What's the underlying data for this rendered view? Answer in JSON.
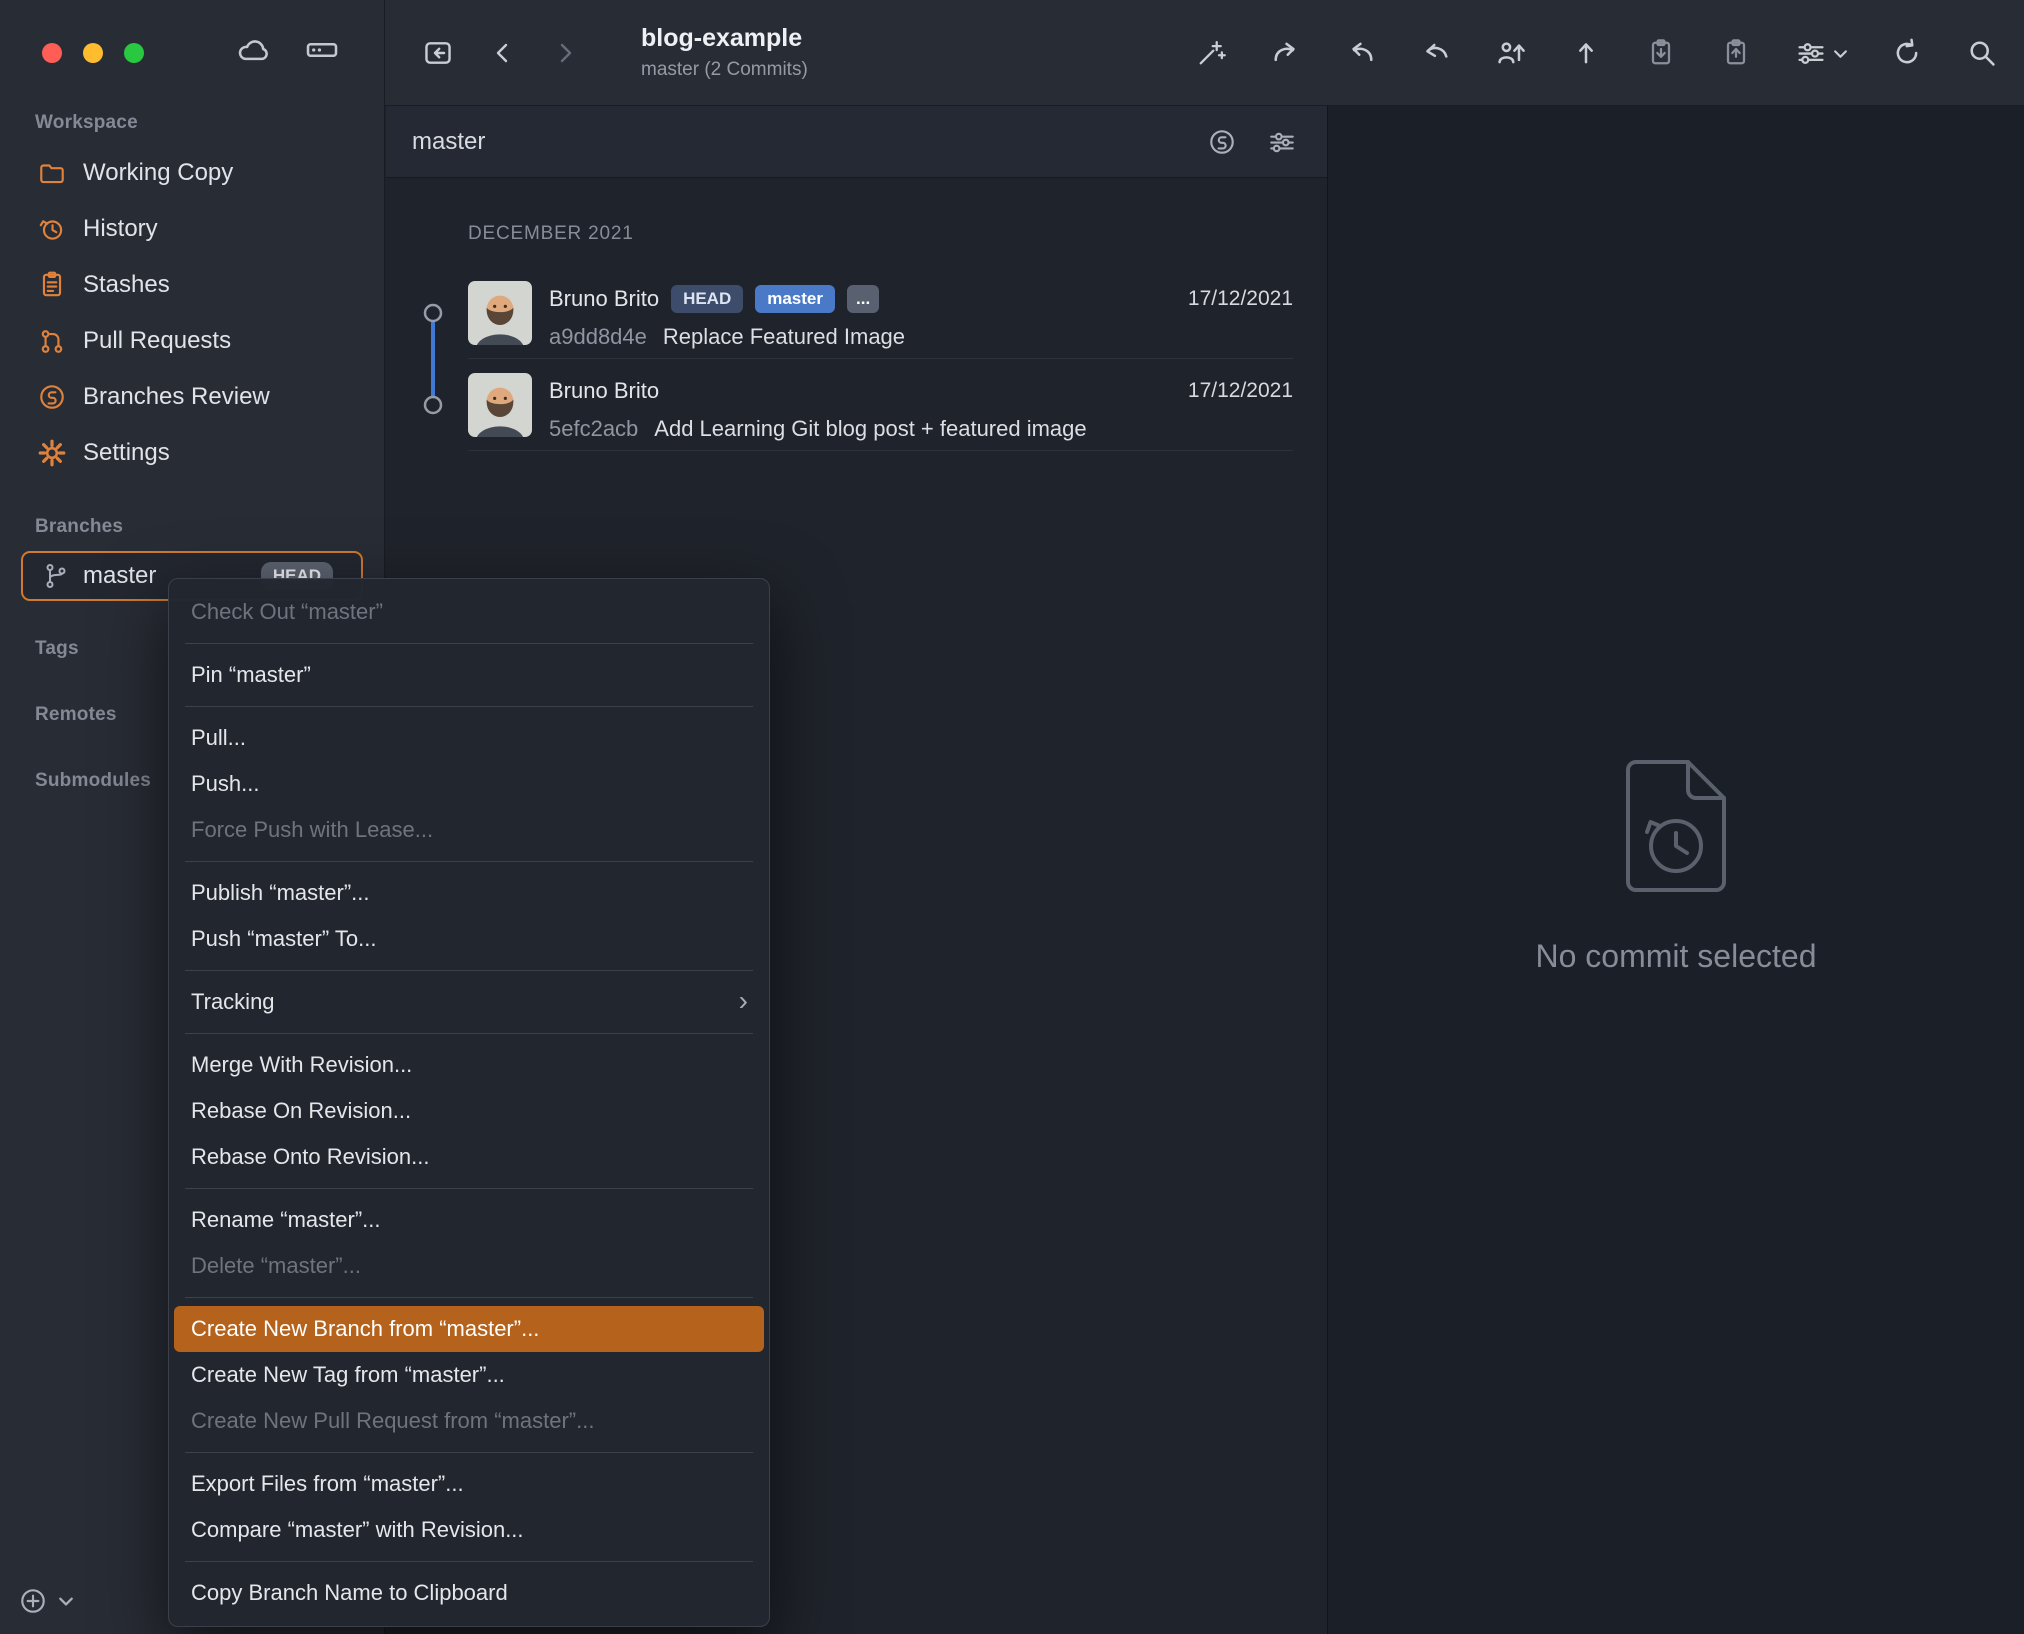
{
  "toolbar": {
    "title": "blog-example",
    "subtitle": "master (2 Commits)"
  },
  "sidebar": {
    "sections": {
      "workspace": "Workspace",
      "branches": "Branches",
      "tags": "Tags",
      "remotes": "Remotes",
      "submodules": "Submodules"
    },
    "workspace_items": [
      {
        "label": "Working Copy"
      },
      {
        "label": "History"
      },
      {
        "label": "Stashes"
      },
      {
        "label": "Pull Requests"
      },
      {
        "label": "Branches Review"
      },
      {
        "label": "Settings"
      }
    ],
    "branch_items": [
      {
        "label": "master",
        "badge": "HEAD"
      }
    ]
  },
  "filter_bar": {
    "branch_label": "master"
  },
  "commit_list": {
    "section_header": "DECEMBER 2021",
    "commits": [
      {
        "author": "Bruno Brito",
        "badges": [
          {
            "label": "HEAD",
            "type": "head"
          },
          {
            "label": "master",
            "type": "branch"
          },
          {
            "label": "...",
            "type": "more"
          }
        ],
        "date": "17/12/2021",
        "hash": "a9dd8d4e",
        "message": "Replace Featured Image"
      },
      {
        "author": "Bruno Brito",
        "date": "17/12/2021",
        "hash": "5efc2acb",
        "message": "Add Learning Git blog post + featured image"
      }
    ]
  },
  "detail_panel": {
    "empty_message": "No commit selected"
  },
  "context_menu": {
    "items": [
      {
        "label": "Check Out “master”",
        "state": "disabled"
      },
      {
        "label": "Pin “master”",
        "state": "normal"
      },
      {
        "label": "Pull...",
        "state": "normal"
      },
      {
        "label": "Push...",
        "state": "normal"
      },
      {
        "label": "Force Push with Lease...",
        "state": "disabled"
      },
      {
        "label": "Publish “master”...",
        "state": "normal"
      },
      {
        "label": "Push “master” To...",
        "state": "normal"
      },
      {
        "label": "Tracking",
        "state": "normal",
        "submenu": true
      },
      {
        "label": "Merge With Revision...",
        "state": "normal"
      },
      {
        "label": "Rebase On Revision...",
        "state": "normal"
      },
      {
        "label": "Rebase Onto Revision...",
        "state": "normal"
      },
      {
        "label": "Rename “master”...",
        "state": "normal"
      },
      {
        "label": "Delete “master”...",
        "state": "disabled"
      },
      {
        "label": "Create New Branch from “master”...",
        "state": "highlighted"
      },
      {
        "label": "Create New Tag from “master”...",
        "state": "normal"
      },
      {
        "label": "Create New Pull Request from “master”...",
        "state": "disabled"
      },
      {
        "label": "Export Files from “master”...",
        "state": "normal"
      },
      {
        "label": "Compare “master” with Revision...",
        "state": "normal"
      },
      {
        "label": "Copy Branch Name to Clipboard",
        "state": "normal"
      }
    ]
  },
  "icons": {
    "submenu_chevron": "›"
  },
  "colors": {
    "accent_orange": "#e0823c",
    "selection_border_orange": "#cf7a2e",
    "menu_highlight_orange": "#b5621c",
    "branch_badge_blue": "#4a7ac7",
    "head_badge_navy": "#3e4c6b",
    "graph_line_blue": "#4179d6",
    "traffic_red": "#ff5e57",
    "traffic_yellow": "#febc2e",
    "traffic_green": "#28c840"
  }
}
